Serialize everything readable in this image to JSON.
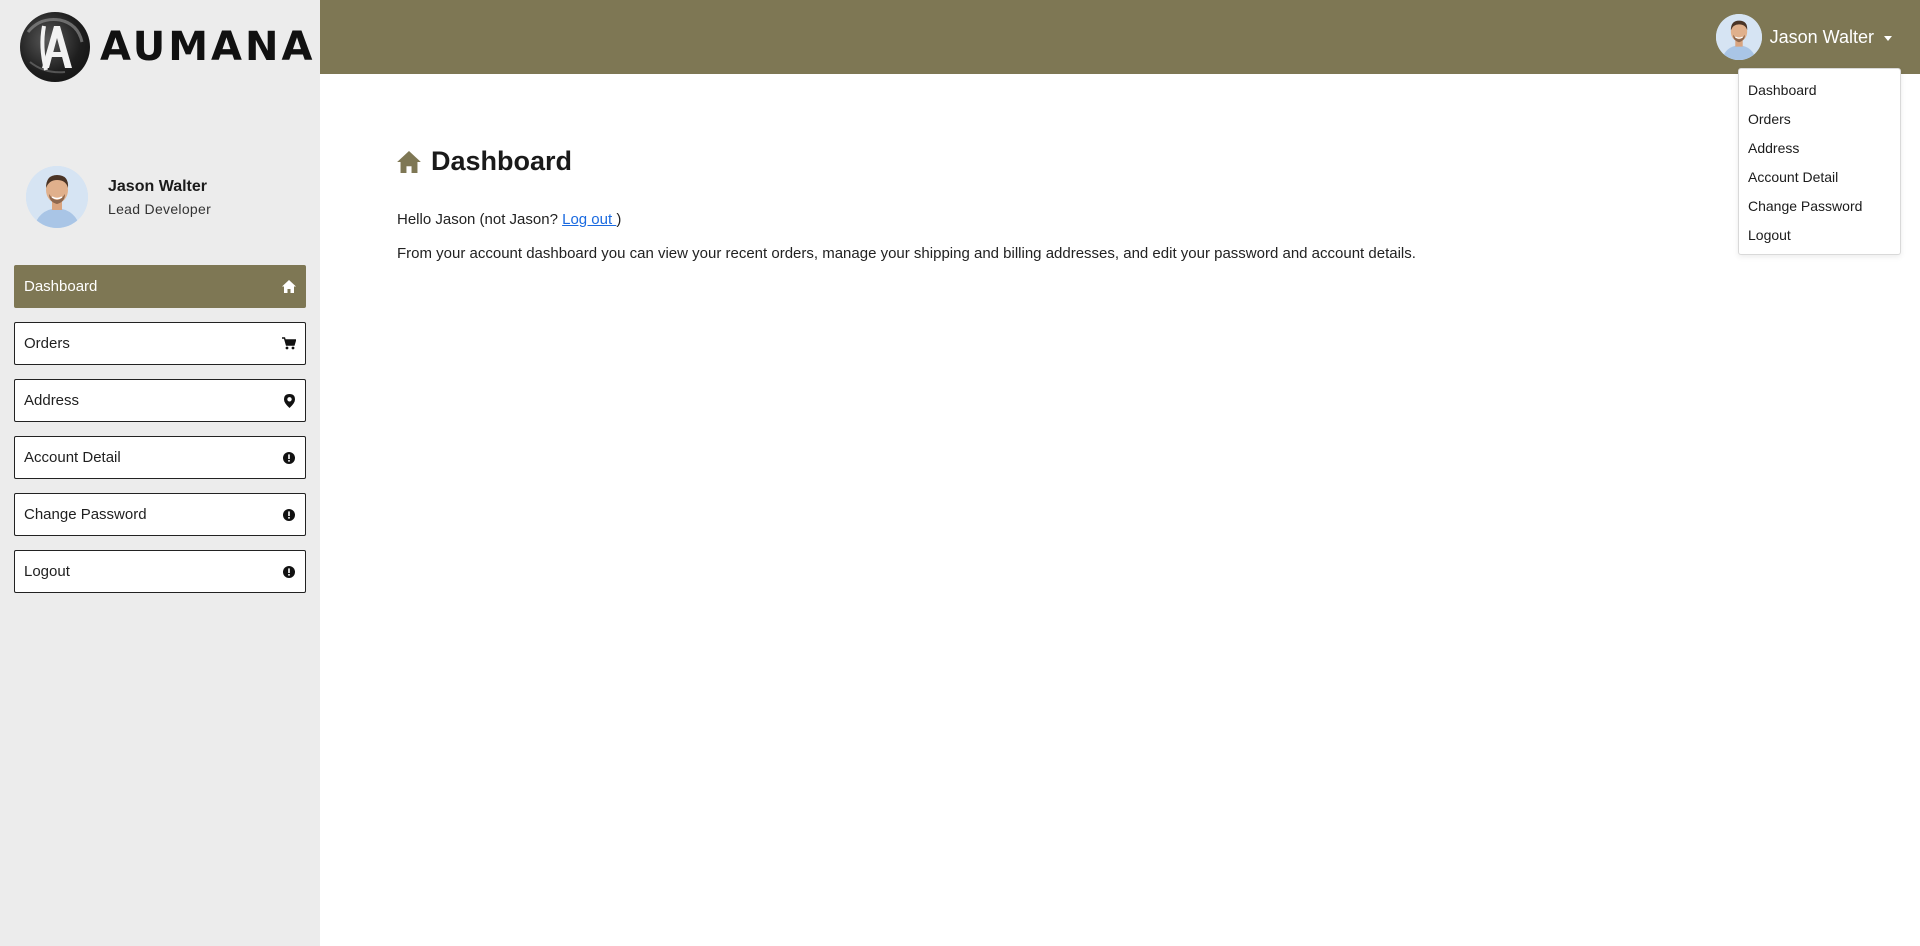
{
  "brand": {
    "name": "AUMANA"
  },
  "user": {
    "name": "Jason Walter",
    "role": "Lead Developer"
  },
  "colors": {
    "accent": "#7e7754",
    "sidebar_bg": "#ececec",
    "link": "#1a6ae0"
  },
  "sidebar": {
    "items": [
      {
        "label": "Dashboard",
        "icon": "home-icon",
        "active": true
      },
      {
        "label": "Orders",
        "icon": "cart-icon",
        "active": false
      },
      {
        "label": "Address",
        "icon": "map-pin-icon",
        "active": false
      },
      {
        "label": "Account Detail",
        "icon": "info-icon",
        "active": false
      },
      {
        "label": "Change Password",
        "icon": "info-icon",
        "active": false
      },
      {
        "label": "Logout",
        "icon": "info-icon",
        "active": false
      }
    ]
  },
  "header": {
    "user_name": "Jason Walter",
    "dropdown": [
      "Dashboard",
      "Orders",
      "Address",
      "Account Detail",
      "Change Password",
      "Logout"
    ]
  },
  "main": {
    "title": "Dashboard",
    "greeting_prefix": "Hello Jason (not Jason? ",
    "logout_link": "Log out ",
    "greeting_suffix": ")",
    "description": "From your account dashboard you can view your recent orders, manage your shipping and billing addresses, and edit your password and account details."
  }
}
